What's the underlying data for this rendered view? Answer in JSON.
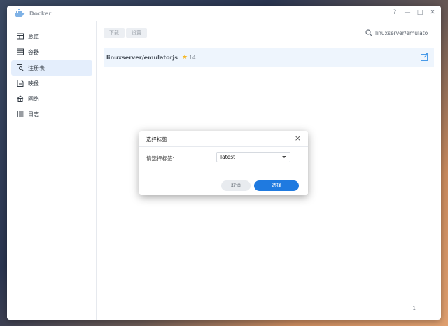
{
  "window": {
    "title": "Docker"
  },
  "controls": {
    "help": "?",
    "minimize": "—",
    "maximize": "□",
    "close": "✕"
  },
  "sidebar": {
    "items": [
      {
        "label": "总览",
        "icon": "overview-icon"
      },
      {
        "label": "容器",
        "icon": "container-icon"
      },
      {
        "label": "注册表",
        "icon": "registry-icon",
        "active": true
      },
      {
        "label": "映像",
        "icon": "image-icon"
      },
      {
        "label": "网络",
        "icon": "network-icon"
      },
      {
        "label": "日志",
        "icon": "log-icon"
      }
    ]
  },
  "toolbar": {
    "download_label": "下载",
    "settings_label": "设置"
  },
  "search": {
    "value": "linuxserver/emulato"
  },
  "repo": {
    "name": "linuxserver/emulatorjs",
    "stars": "14"
  },
  "pager": {
    "page": "1"
  },
  "dialog": {
    "title": "选择标签",
    "field_label": "请选择标签:",
    "selected_tag": "latest",
    "cancel_label": "取消",
    "ok_label": "选择"
  },
  "colors": {
    "accent": "#1f7ae0",
    "active_bg": "#e4eefc",
    "row_bg": "#eef5fd",
    "star": "#f5b828"
  }
}
